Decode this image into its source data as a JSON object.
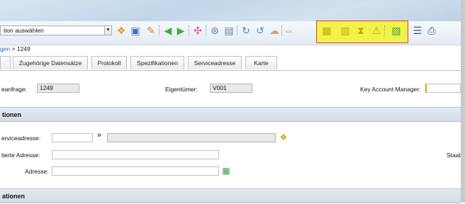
{
  "toolbar": {
    "action_select": "tion auswählen",
    "icons": [
      "new-record-icon",
      "save-icon",
      "edit-icon",
      "back-arrow-icon",
      "forward-arrow-icon",
      "workflow-icon",
      "search-icon",
      "notes-icon",
      "refresh-icon",
      "refresh-alt-icon",
      "cloud-icon",
      "share-icon",
      "data-icon",
      "hourglass-icon",
      "warning-icon",
      "report-icon",
      "list-icon",
      "print-icon"
    ]
  },
  "breadcrumb": {
    "link": "gen",
    "separator": " > ",
    "current": "1249"
  },
  "tabs": [
    "",
    "Zugehörige Datensätze",
    "Protokoll",
    "Spezifikationen",
    "Serviceadresse",
    "Karte"
  ],
  "header_fields": {
    "anfrage_label": "eanfrage:",
    "anfrage_value": "1249",
    "owner_label": "Eigentümer:",
    "owner_value": "V001",
    "kam_label": "Key Account Manager:"
  },
  "sections": {
    "first": "tionen",
    "second": "ationen"
  },
  "address": {
    "service_label": "erviceadresse:",
    "validated_label": "tierte Adresse:",
    "address_label": "Adresse:",
    "right_label": "Staat"
  }
}
